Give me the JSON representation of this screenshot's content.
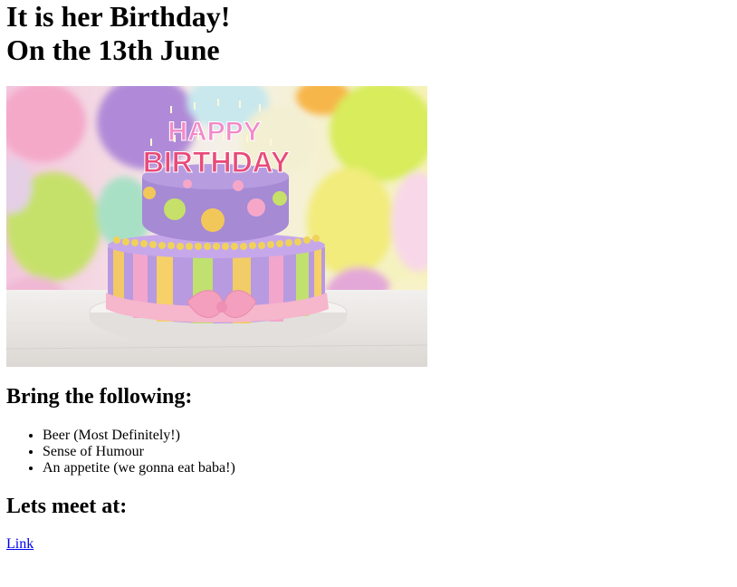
{
  "heading": {
    "line1": "It is her Birthday!",
    "line2": "On the 13th June"
  },
  "hero_image": {
    "icon": "birthday-cake-icon",
    "cake_lettering_top": "HAPPY",
    "cake_lettering_bottom": "BIRTHDAY"
  },
  "bring": {
    "title": "Bring the following:",
    "items": [
      "Beer (Most Definitely!)",
      "Sense of Humour",
      "An appetite (we gonna eat baba!)"
    ]
  },
  "meet": {
    "title": "Lets meet at:",
    "link_label": "Link"
  },
  "colors": {
    "link": "#0000ee",
    "text": "#000000"
  }
}
